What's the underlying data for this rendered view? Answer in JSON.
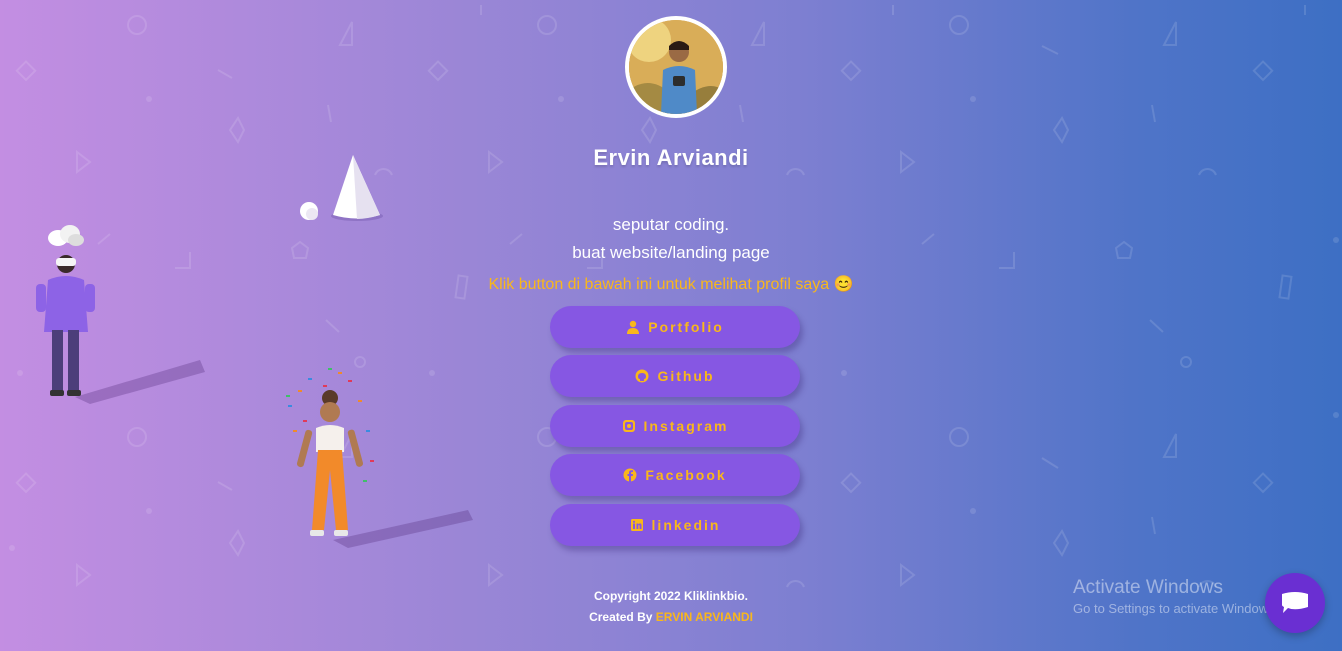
{
  "profile": {
    "name": "Ervin Arviandi",
    "bio_line1": "seputar coding.",
    "bio_line2": "buat website/landing page",
    "hint": "Klik button di bawah ini untuk melihat profil saya 😊"
  },
  "links": [
    {
      "label": "Portfolio",
      "icon": "user-icon"
    },
    {
      "label": "Github",
      "icon": "github-icon"
    },
    {
      "label": "Instagram",
      "icon": "instagram-icon"
    },
    {
      "label": "Facebook",
      "icon": "facebook-icon"
    },
    {
      "label": "linkedin",
      "icon": "linkedin-icon"
    }
  ],
  "footer": {
    "copyright": "Copyright 2022 Kliklinkbio.",
    "created_by": "Created By",
    "author": "ERVIN ARVIANDI"
  },
  "watermark": {
    "title": "Activate Windows",
    "subtitle": "Go to Settings to activate Windows."
  },
  "colors": {
    "accent": "#f9b71b",
    "button": "#8657e3",
    "chat": "#6a2fd2"
  }
}
